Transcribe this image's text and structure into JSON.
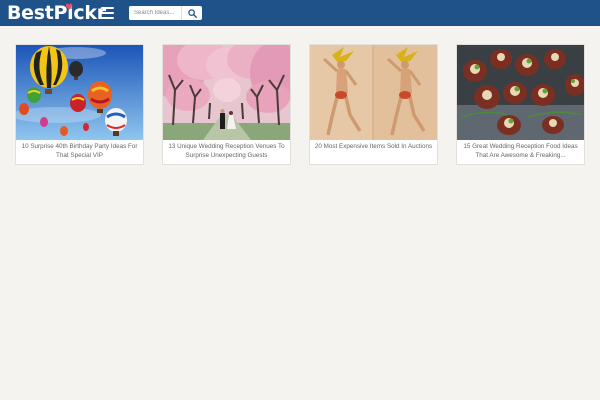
{
  "header": {
    "logo": "BestPickr",
    "search": {
      "placeholder": "Search Ideas..."
    }
  },
  "cards": [
    {
      "title": "10 Surprise 40th Birthday Party Ideas For That Special VIP"
    },
    {
      "title": "13 Unique Wedding Reception Venues To Surprise Unexpecting Guests"
    },
    {
      "title": "20 Most Expensive Items Sold In Auctions"
    },
    {
      "title": "15 Great Wedding Reception Food Ideas That Are Awesome & Freaking..."
    }
  ],
  "colors": {
    "header": "#1f5289",
    "background": "#f4f3ef"
  },
  "icons": [
    "menu-icon",
    "search-icon"
  ]
}
